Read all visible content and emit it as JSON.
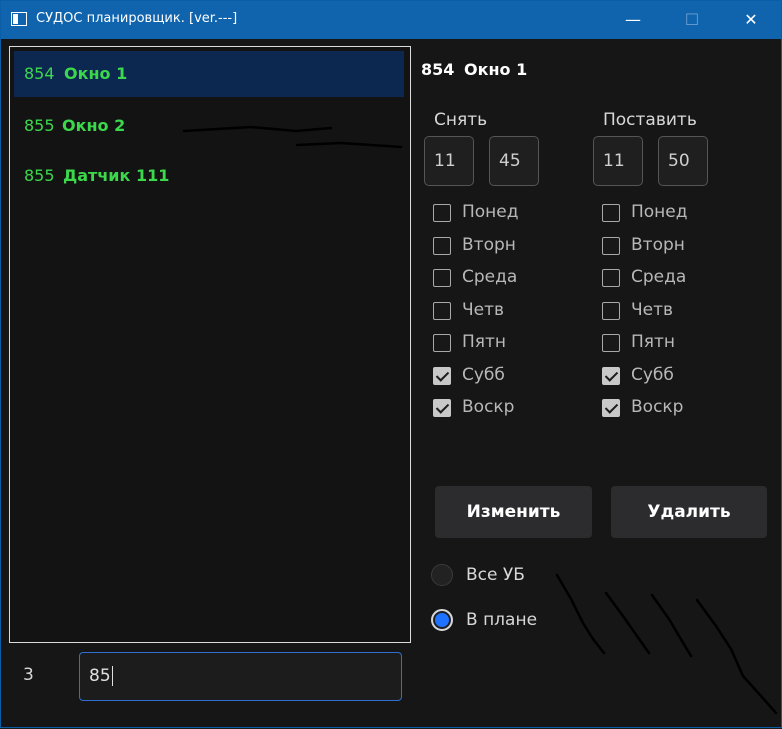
{
  "window": {
    "title": "СУДОС планировщик. [ver.---]",
    "controls": {
      "minimize": "—",
      "maximize": "☐",
      "close": "✕"
    }
  },
  "list": {
    "items": [
      {
        "num": "854",
        "name": "Окно 1",
        "selected": true
      },
      {
        "num": "855",
        "name": "Окно 2",
        "selected": false
      },
      {
        "num": "855",
        "name": "Датчик 111",
        "selected": false
      }
    ]
  },
  "detail": {
    "num": "854",
    "name": "Окно 1",
    "remove": {
      "label": "Снять",
      "hour": "11",
      "minute": "45",
      "days": [
        {
          "label": "Понед",
          "checked": false
        },
        {
          "label": "Вторн",
          "checked": false
        },
        {
          "label": "Среда",
          "checked": false
        },
        {
          "label": "Четв",
          "checked": false
        },
        {
          "label": "Пятн",
          "checked": false
        },
        {
          "label": "Субб",
          "checked": true
        },
        {
          "label": "Воскр",
          "checked": true
        }
      ]
    },
    "set": {
      "label": "Поставить",
      "hour": "11",
      "minute": "50",
      "days": [
        {
          "label": "Понед",
          "checked": false
        },
        {
          "label": "Вторн",
          "checked": false
        },
        {
          "label": "Среда",
          "checked": false
        },
        {
          "label": "Четв",
          "checked": false
        },
        {
          "label": "Пятн",
          "checked": false
        },
        {
          "label": "Субб",
          "checked": true
        },
        {
          "label": "Воскр",
          "checked": true
        }
      ]
    }
  },
  "actions": {
    "edit_label": "Изменить",
    "delete_label": "Удалить"
  },
  "filter": {
    "options": [
      {
        "label": "Все УБ",
        "selected": false
      },
      {
        "label": "В плане",
        "selected": true
      }
    ]
  },
  "footer": {
    "count": "3",
    "input_value": "85"
  },
  "colors": {
    "accent": "#0f64ad",
    "item_text": "#3bd84c",
    "selected_bg": "#0c2850",
    "radio_on": "#1f72ff"
  }
}
